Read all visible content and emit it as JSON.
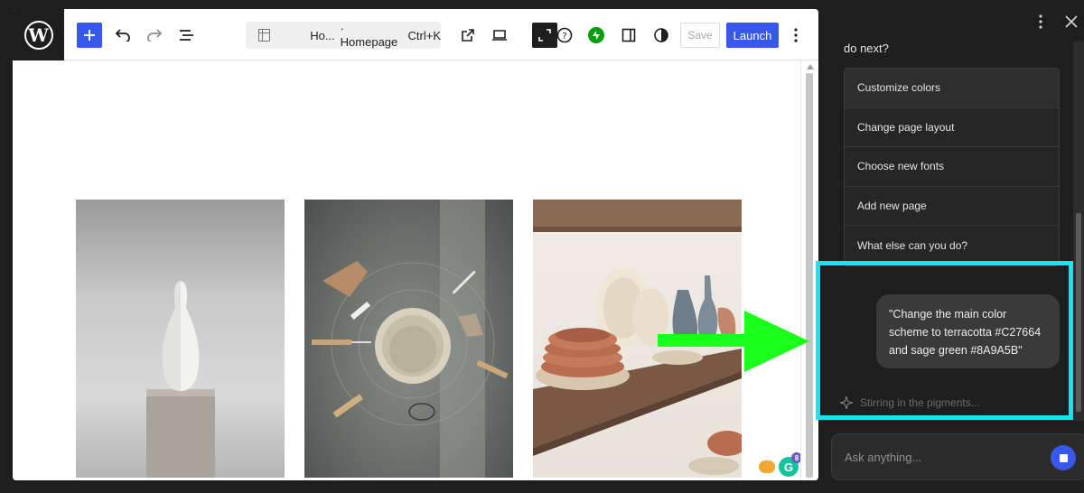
{
  "toolbar": {
    "doc_title": "Ho...",
    "doc_separator": "· Homepage",
    "doc_shortcut": "Ctrl+K",
    "save_label": "Save",
    "launch_label": "Launch"
  },
  "canvas": {
    "images": [
      {
        "alt": "white vase on concrete plinth"
      },
      {
        "alt": "pottery bowl with clay tools"
      },
      {
        "alt": "ceramic dishes on wooden shelf"
      }
    ],
    "grammarly_count": "8"
  },
  "assistant": {
    "question_tail": "do next?",
    "suggestions": [
      "Customize colors",
      "Change page layout",
      "Choose new fonts",
      "Add new page",
      "What else can you do?"
    ],
    "user_message": "\"Change the main color scheme to terracotta #C27664 and sage green #8A9A5B\"",
    "status": "Stirring in the pigments...",
    "input_placeholder": "Ask anything..."
  },
  "colors": {
    "accent": "#3858e9",
    "highlight": "#17e4ee",
    "arrow": "#1aff1a"
  }
}
